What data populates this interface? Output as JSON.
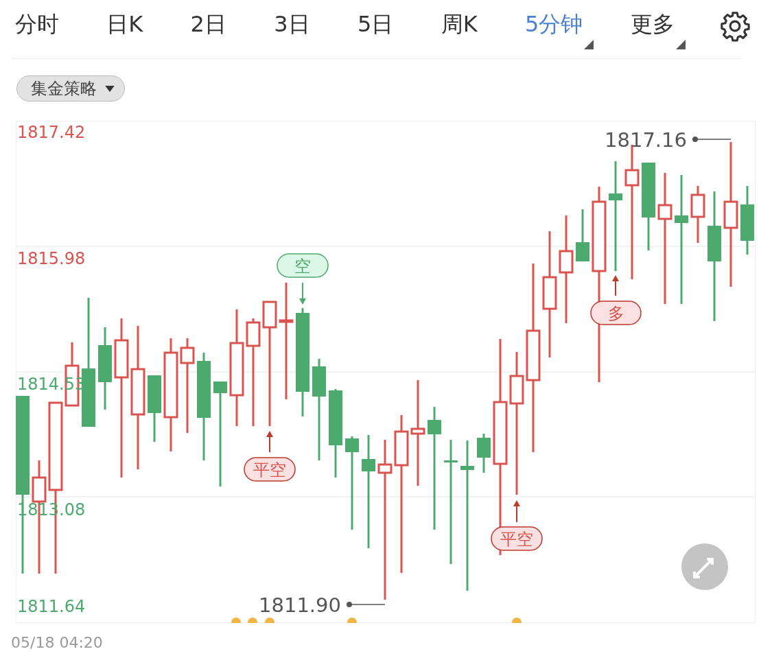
{
  "tabs": [
    {
      "label": "分时",
      "selected": false,
      "menu": false
    },
    {
      "label": "日K",
      "selected": false,
      "menu": false
    },
    {
      "label": "2日",
      "selected": false,
      "menu": false
    },
    {
      "label": "3日",
      "selected": false,
      "menu": false
    },
    {
      "label": "5日",
      "selected": false,
      "menu": false
    },
    {
      "label": "周K",
      "selected": false,
      "menu": false
    },
    {
      "label": "5分钟",
      "selected": true,
      "menu": true
    },
    {
      "label": "更多",
      "selected": false,
      "menu": true
    }
  ],
  "strategy_dropdown": {
    "label": "集金策略"
  },
  "chart": {
    "y_labels": [
      {
        "text": "1817.42",
        "color": "#d9534f"
      },
      {
        "text": "1815.98",
        "color": "#d9534f"
      },
      {
        "text": "1814.53",
        "color": "#4caa6e"
      },
      {
        "text": "1813.08",
        "color": "#4caa6e"
      },
      {
        "text": "1811.64",
        "color": "#4caa6e"
      }
    ],
    "high_label": "1817.16",
    "low_label": "1811.90",
    "signals": [
      {
        "text": "空",
        "kind": "sell"
      },
      {
        "text": "平空",
        "kind": "buy"
      },
      {
        "text": "平空",
        "kind": "buy"
      },
      {
        "text": "多",
        "kind": "buy"
      }
    ]
  },
  "time_label": "05/18 04:20"
}
